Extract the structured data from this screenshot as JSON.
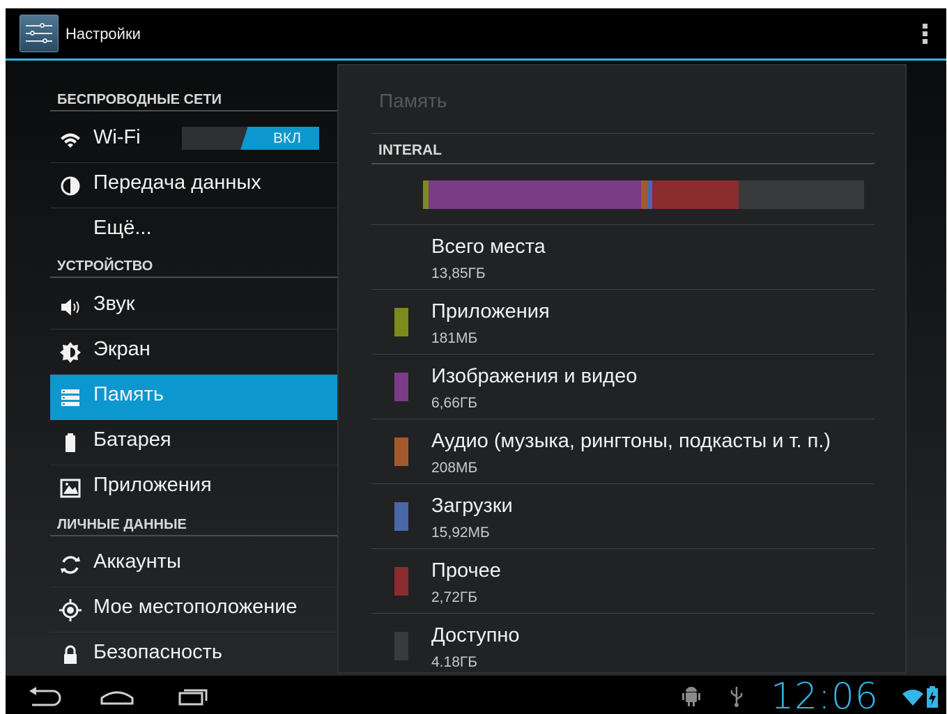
{
  "app": {
    "title": "Настройки"
  },
  "sidebar": {
    "sections": [
      {
        "header": "БЕСПРОВОДНЫЕ СЕТИ"
      },
      {
        "header": "УСТРОЙСТВО"
      },
      {
        "header": "ЛИЧНЫЕ ДАННЫЕ"
      }
    ],
    "items": [
      {
        "label": "Wi-Fi",
        "icon": "wifi-icon",
        "toggle": "ВКЛ"
      },
      {
        "label": "Передача данных",
        "icon": "data-usage-icon"
      },
      {
        "label": "Ещё...",
        "icon": ""
      },
      {
        "label": "Звук",
        "icon": "speaker-icon"
      },
      {
        "label": "Экран",
        "icon": "brightness-icon"
      },
      {
        "label": "Память",
        "icon": "storage-icon",
        "selected": true
      },
      {
        "label": "Батарея",
        "icon": "battery-icon"
      },
      {
        "label": "Приложения",
        "icon": "apps-icon"
      },
      {
        "label": "Аккаунты",
        "icon": "sync-icon"
      },
      {
        "label": "Мое местоположение",
        "icon": "location-icon"
      },
      {
        "label": "Безопасность",
        "icon": "lock-icon"
      }
    ]
  },
  "panel": {
    "title": "Память",
    "category": "INTERAL",
    "usage_bar": [
      {
        "name": "Приложения",
        "color": "#7d8a1c",
        "fraction": 0.013
      },
      {
        "name": "Изображения и видео",
        "color": "#7b3c87",
        "fraction": 0.481
      },
      {
        "name": "Аудио",
        "color": "#a4592c",
        "fraction": 0.015
      },
      {
        "name": "Загрузки",
        "color": "#4a68a9",
        "fraction": 0.011
      },
      {
        "name": "Прочее",
        "color": "#8b2c2f",
        "fraction": 0.196
      },
      {
        "name": "Доступно",
        "color": "#383a3c",
        "fraction": 0.284
      }
    ],
    "rows": [
      {
        "title": "Всего места",
        "value": "13,85ГБ",
        "color": ""
      },
      {
        "title": "Приложения",
        "value": "181МБ",
        "color": "#7d8a1c"
      },
      {
        "title": "Изображения и видео",
        "value": "6,66ГБ",
        "color": "#7b3c87"
      },
      {
        "title": "Аудио (музыка, рингтоны, подкасты и т. п.)",
        "value": "208МБ",
        "color": "#a4592c"
      },
      {
        "title": "Загрузки",
        "value": "15,92МБ",
        "color": "#4a68a9"
      },
      {
        "title": "Прочее",
        "value": "2,72ГБ",
        "color": "#8b2c2f"
      },
      {
        "title": "Доступно",
        "value": "4.18ГБ",
        "color": "#383a3c"
      }
    ]
  },
  "status": {
    "clock": "12:06"
  },
  "colors": {
    "accent": "#33b5e5",
    "selected": "#0d97cf"
  }
}
